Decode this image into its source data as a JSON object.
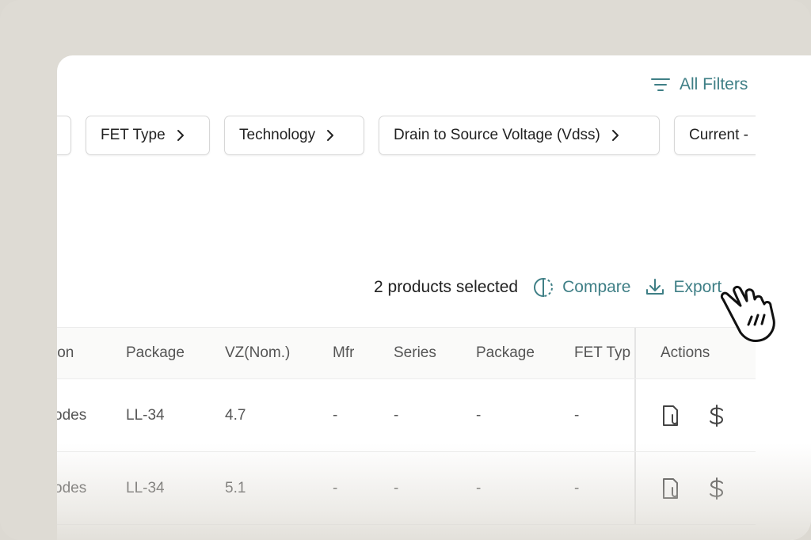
{
  "toolbar": {
    "all_filters_label": "All Filters"
  },
  "filters": {
    "chips": [
      {
        "label": ""
      },
      {
        "label": "FET Type"
      },
      {
        "label": "Technology"
      },
      {
        "label": "Drain to Source Voltage (Vdss)"
      },
      {
        "label": "Current -"
      }
    ]
  },
  "selection": {
    "count_text": "2 products selected",
    "compare_label": "Compare",
    "export_label": "Export"
  },
  "table": {
    "columns": [
      "ion",
      "Package",
      "VZ(Nom.)",
      "Mfr",
      "Series",
      "Package",
      "FET Typ",
      "Actions"
    ],
    "rows": [
      {
        "cells": [
          "odes",
          "LL-34",
          "4.7",
          "-",
          "-",
          "-",
          "-"
        ]
      },
      {
        "cells": [
          "odes",
          "LL-34",
          "5.1",
          "-",
          "-",
          "-",
          "-"
        ]
      }
    ]
  },
  "icons": {
    "filter": "filter-lines-icon",
    "chevron": "chevron-right-icon",
    "compare": "compare-icon",
    "export": "download-icon",
    "datasheet": "document-attachment-icon",
    "price": "dollar-icon",
    "cursor": "hand-pointer-icon"
  },
  "colors": {
    "accent": "#3f7f86",
    "text": "#222222",
    "muted": "#555555",
    "background": "#dedbd4"
  }
}
